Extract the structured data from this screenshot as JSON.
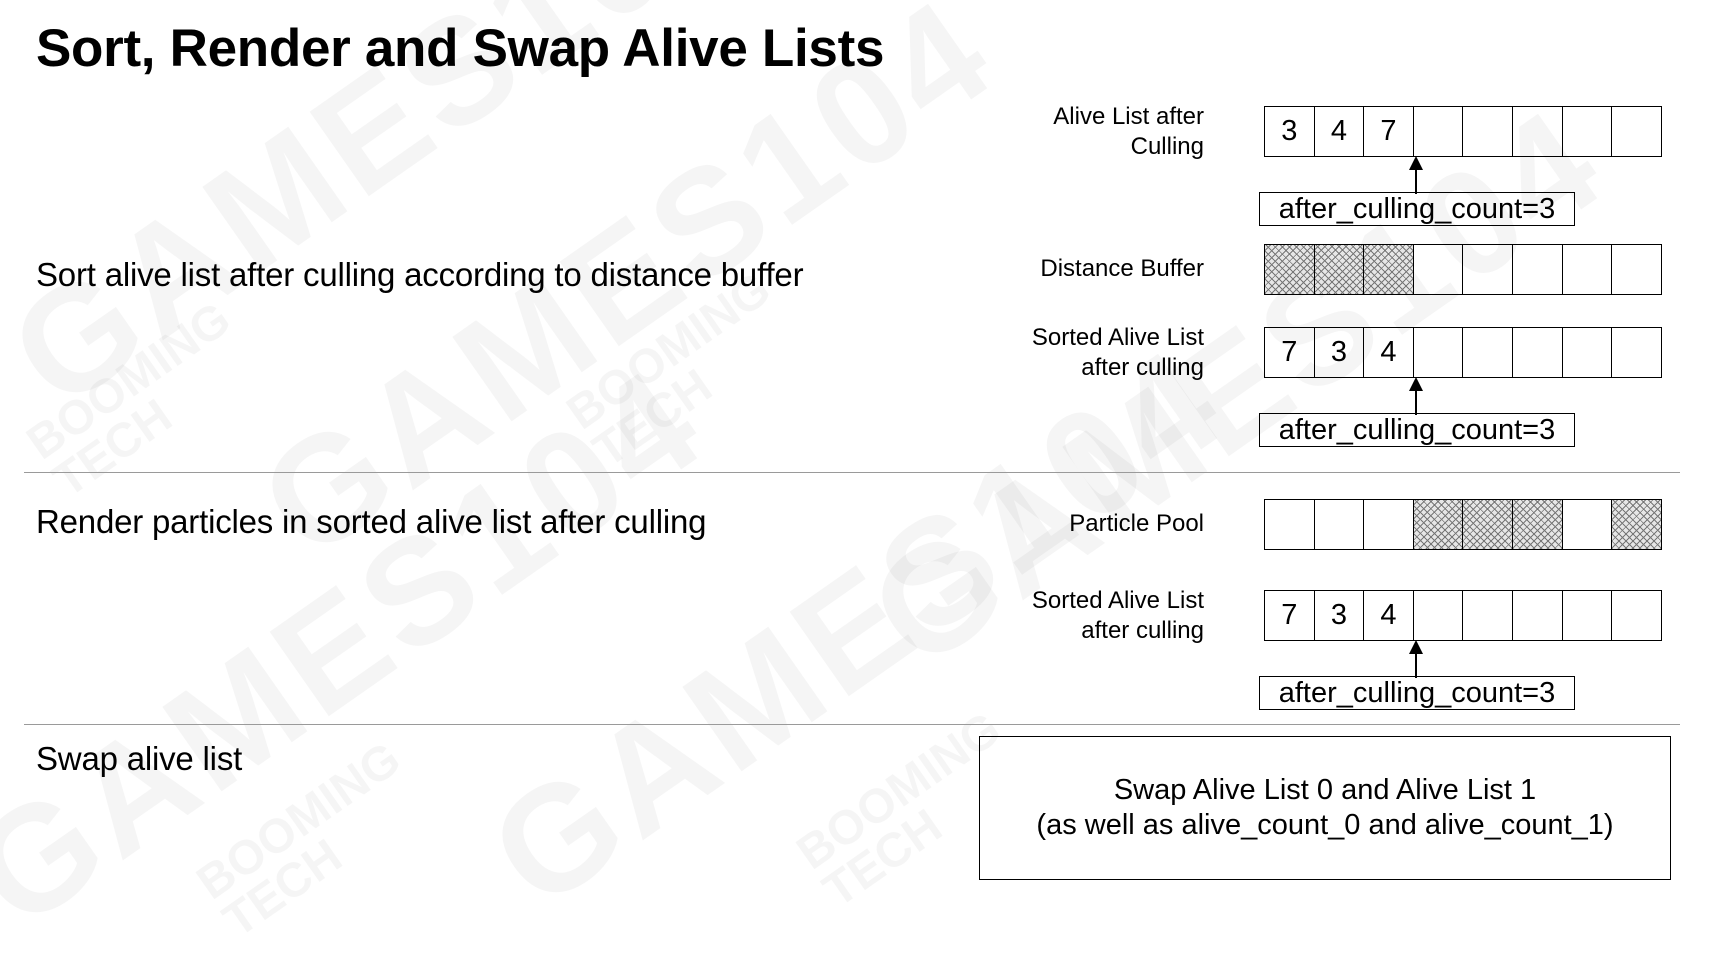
{
  "title": "Sort, Render and Swap Alive Lists",
  "watermark": {
    "main": "GAMES104",
    "brand_line1": "BOOMING",
    "brand_line2": "TECH"
  },
  "sections": {
    "sort": "Sort alive list after culling according to distance buffer",
    "render": "Render particles in sorted alive list after culling",
    "swap": "Swap alive list"
  },
  "rows": [
    {
      "label_line1": "Alive List after",
      "label_line2": "Culling",
      "cells": [
        "3",
        "4",
        "7",
        "",
        "",
        "",
        "",
        ""
      ],
      "filled": [
        false,
        false,
        false,
        false,
        false,
        false,
        false,
        false
      ],
      "count_label": "after_culling_count=3"
    },
    {
      "label_line1": "Distance Buffer",
      "label_line2": "",
      "cells": [
        "",
        "",
        "",
        "",
        "",
        "",
        "",
        ""
      ],
      "filled": [
        true,
        true,
        true,
        false,
        false,
        false,
        false,
        false
      ],
      "count_label": ""
    },
    {
      "label_line1": "Sorted Alive List",
      "label_line2": "after culling",
      "cells": [
        "7",
        "3",
        "4",
        "",
        "",
        "",
        "",
        ""
      ],
      "filled": [
        false,
        false,
        false,
        false,
        false,
        false,
        false,
        false
      ],
      "count_label": "after_culling_count=3"
    },
    {
      "label_line1": "Particle Pool",
      "label_line2": "",
      "cells": [
        "",
        "",
        "",
        "",
        "",
        "",
        "",
        ""
      ],
      "filled": [
        false,
        false,
        false,
        true,
        true,
        true,
        false,
        true
      ],
      "count_label": ""
    },
    {
      "label_line1": "Sorted Alive List",
      "label_line2": "after culling",
      "cells": [
        "7",
        "3",
        "4",
        "",
        "",
        "",
        "",
        ""
      ],
      "filled": [
        false,
        false,
        false,
        false,
        false,
        false,
        false,
        false
      ],
      "count_label": "after_culling_count=3"
    }
  ],
  "swap_box": {
    "line1": "Swap Alive List 0 and Alive List 1",
    "line2": "(as well as alive_count_0 and alive_count_1)"
  },
  "colors": {
    "divider": "#9a9a9a",
    "hatch_fill": "#e6e6e6",
    "hatch_line": "#777777"
  }
}
